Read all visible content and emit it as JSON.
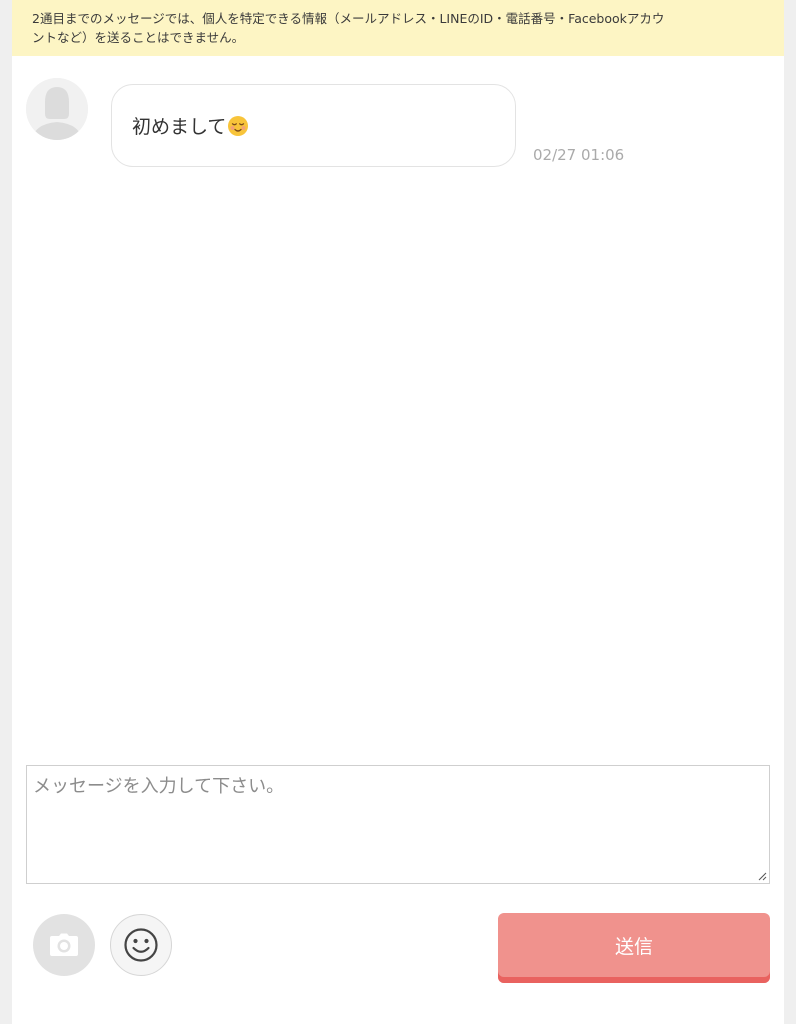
{
  "notice": {
    "line1": "2通目までのメッセージでは、個人を特定できる情報（メールアドレス・LINEのID・電話番号・Facebookアカウ",
    "line2": "ントなど）を送ることはできません。"
  },
  "messages": [
    {
      "text": "初めまして",
      "emoji": "relieved-smiling-face",
      "timestamp": "02/27 01:06"
    }
  ],
  "composer": {
    "placeholder": "メッセージを入力して下さい。",
    "value": ""
  },
  "buttons": {
    "camera_icon": "camera-icon",
    "emoji_icon": "smiley-face-icon",
    "send_label": "送信"
  },
  "colors": {
    "notice_bg": "#fdf5c4",
    "send_bg": "#f0928d",
    "send_shadow": "#e9625f"
  }
}
